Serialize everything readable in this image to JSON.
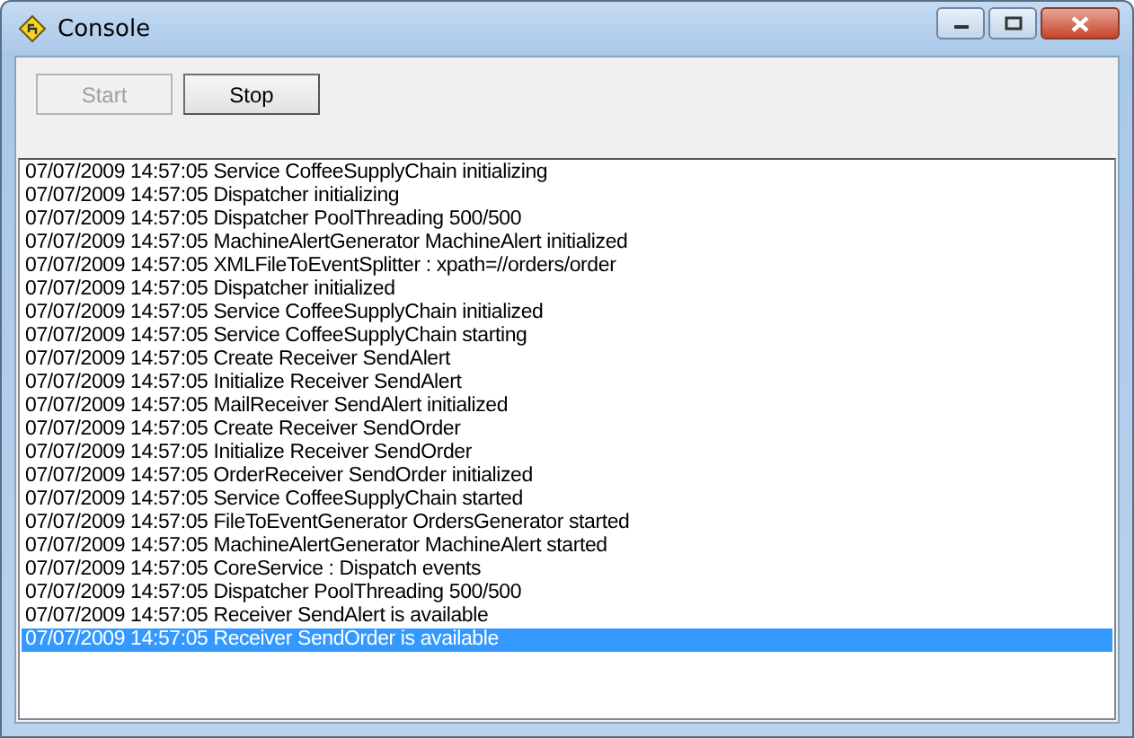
{
  "window": {
    "title": "Console"
  },
  "buttons": [
    {
      "label": "Start",
      "disabled": true
    },
    {
      "label": "Stop",
      "disabled": false
    }
  ],
  "log": [
    {
      "text": "07/07/2009 14:57:05 Service CoffeeSupplyChain initializing",
      "selected": false
    },
    {
      "text": "07/07/2009 14:57:05 Dispatcher initializing",
      "selected": false
    },
    {
      "text": "07/07/2009 14:57:05 Dispatcher PoolThreading 500/500",
      "selected": false
    },
    {
      "text": "07/07/2009 14:57:05 MachineAlertGenerator MachineAlert initialized",
      "selected": false
    },
    {
      "text": "07/07/2009 14:57:05 XMLFileToEventSplitter : xpath=//orders/order",
      "selected": false
    },
    {
      "text": "07/07/2009 14:57:05 Dispatcher initialized",
      "selected": false
    },
    {
      "text": "07/07/2009 14:57:05 Service CoffeeSupplyChain initialized",
      "selected": false
    },
    {
      "text": "07/07/2009 14:57:05 Service CoffeeSupplyChain starting",
      "selected": false
    },
    {
      "text": "07/07/2009 14:57:05 Create Receiver SendAlert",
      "selected": false
    },
    {
      "text": "07/07/2009 14:57:05 Initialize Receiver SendAlert",
      "selected": false
    },
    {
      "text": "07/07/2009 14:57:05 MailReceiver SendAlert initialized",
      "selected": false
    },
    {
      "text": "07/07/2009 14:57:05 Create Receiver SendOrder",
      "selected": false
    },
    {
      "text": "07/07/2009 14:57:05 Initialize Receiver SendOrder",
      "selected": false
    },
    {
      "text": "07/07/2009 14:57:05 OrderReceiver SendOrder initialized",
      "selected": false
    },
    {
      "text": "07/07/2009 14:57:05 Service CoffeeSupplyChain started",
      "selected": false
    },
    {
      "text": "07/07/2009 14:57:05 FileToEventGenerator OrdersGenerator started",
      "selected": false
    },
    {
      "text": "07/07/2009 14:57:05 MachineAlertGenerator MachineAlert started",
      "selected": false
    },
    {
      "text": "07/07/2009 14:57:05 CoreService : Dispatch events",
      "selected": false
    },
    {
      "text": "07/07/2009 14:57:05 Dispatcher PoolThreading 500/500",
      "selected": false
    },
    {
      "text": "07/07/2009 14:57:05 Receiver SendAlert is available",
      "selected": false
    },
    {
      "text": "07/07/2009 14:57:05 Receiver SendOrder is available",
      "selected": true
    }
  ]
}
